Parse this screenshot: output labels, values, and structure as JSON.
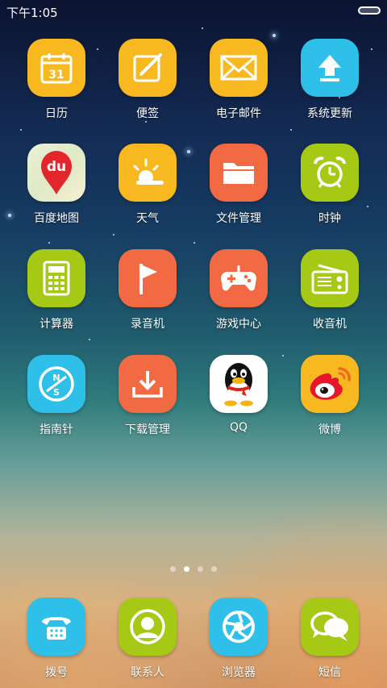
{
  "status_bar": {
    "time": "下午1:05"
  },
  "apps": [
    {
      "label": "日历",
      "icon": "calendar-icon",
      "color": "#F8B81F",
      "date": "31"
    },
    {
      "label": "便签",
      "icon": "notepad-icon",
      "color": "#F8B81F"
    },
    {
      "label": "电子邮件",
      "icon": "email-icon",
      "color": "#F8B81F"
    },
    {
      "label": "系统更新",
      "icon": "system-update-icon",
      "color": "#2EC0E8"
    },
    {
      "label": "百度地图",
      "icon": "baidu-map-icon",
      "color": "#E4EFD2",
      "badge": "du"
    },
    {
      "label": "天气",
      "icon": "weather-icon",
      "color": "#F8B81F"
    },
    {
      "label": "文件管理",
      "icon": "folder-icon",
      "color": "#F26A43"
    },
    {
      "label": "时钟",
      "icon": "alarm-clock-icon",
      "color": "#A5C914"
    },
    {
      "label": "计算器",
      "icon": "calculator-icon",
      "color": "#A5C914"
    },
    {
      "label": "录音机",
      "icon": "recorder-icon",
      "color": "#F26A43"
    },
    {
      "label": "游戏中心",
      "icon": "gamepad-icon",
      "color": "#F26A43"
    },
    {
      "label": "收音机",
      "icon": "radio-icon",
      "color": "#A5C914"
    },
    {
      "label": "指南针",
      "icon": "compass-icon",
      "color": "#2EC0E8",
      "north": "N",
      "south": "S"
    },
    {
      "label": "下载管理",
      "icon": "download-icon",
      "color": "#F26A43"
    },
    {
      "label": "QQ",
      "icon": "qq-penguin-icon",
      "color": "#FFFFFF"
    },
    {
      "label": "微博",
      "icon": "weibo-icon",
      "color": "#F8B81F"
    }
  ],
  "page_indicator": {
    "count": 4,
    "active": 2
  },
  "dock": [
    {
      "label": "拨号",
      "icon": "phone-icon",
      "color": "#2EC0E8"
    },
    {
      "label": "联系人",
      "icon": "contacts-icon",
      "color": "#A5C914"
    },
    {
      "label": "浏览器",
      "icon": "browser-icon",
      "color": "#2EC0E8"
    },
    {
      "label": "短信",
      "icon": "messages-icon",
      "color": "#A5C914"
    }
  ]
}
